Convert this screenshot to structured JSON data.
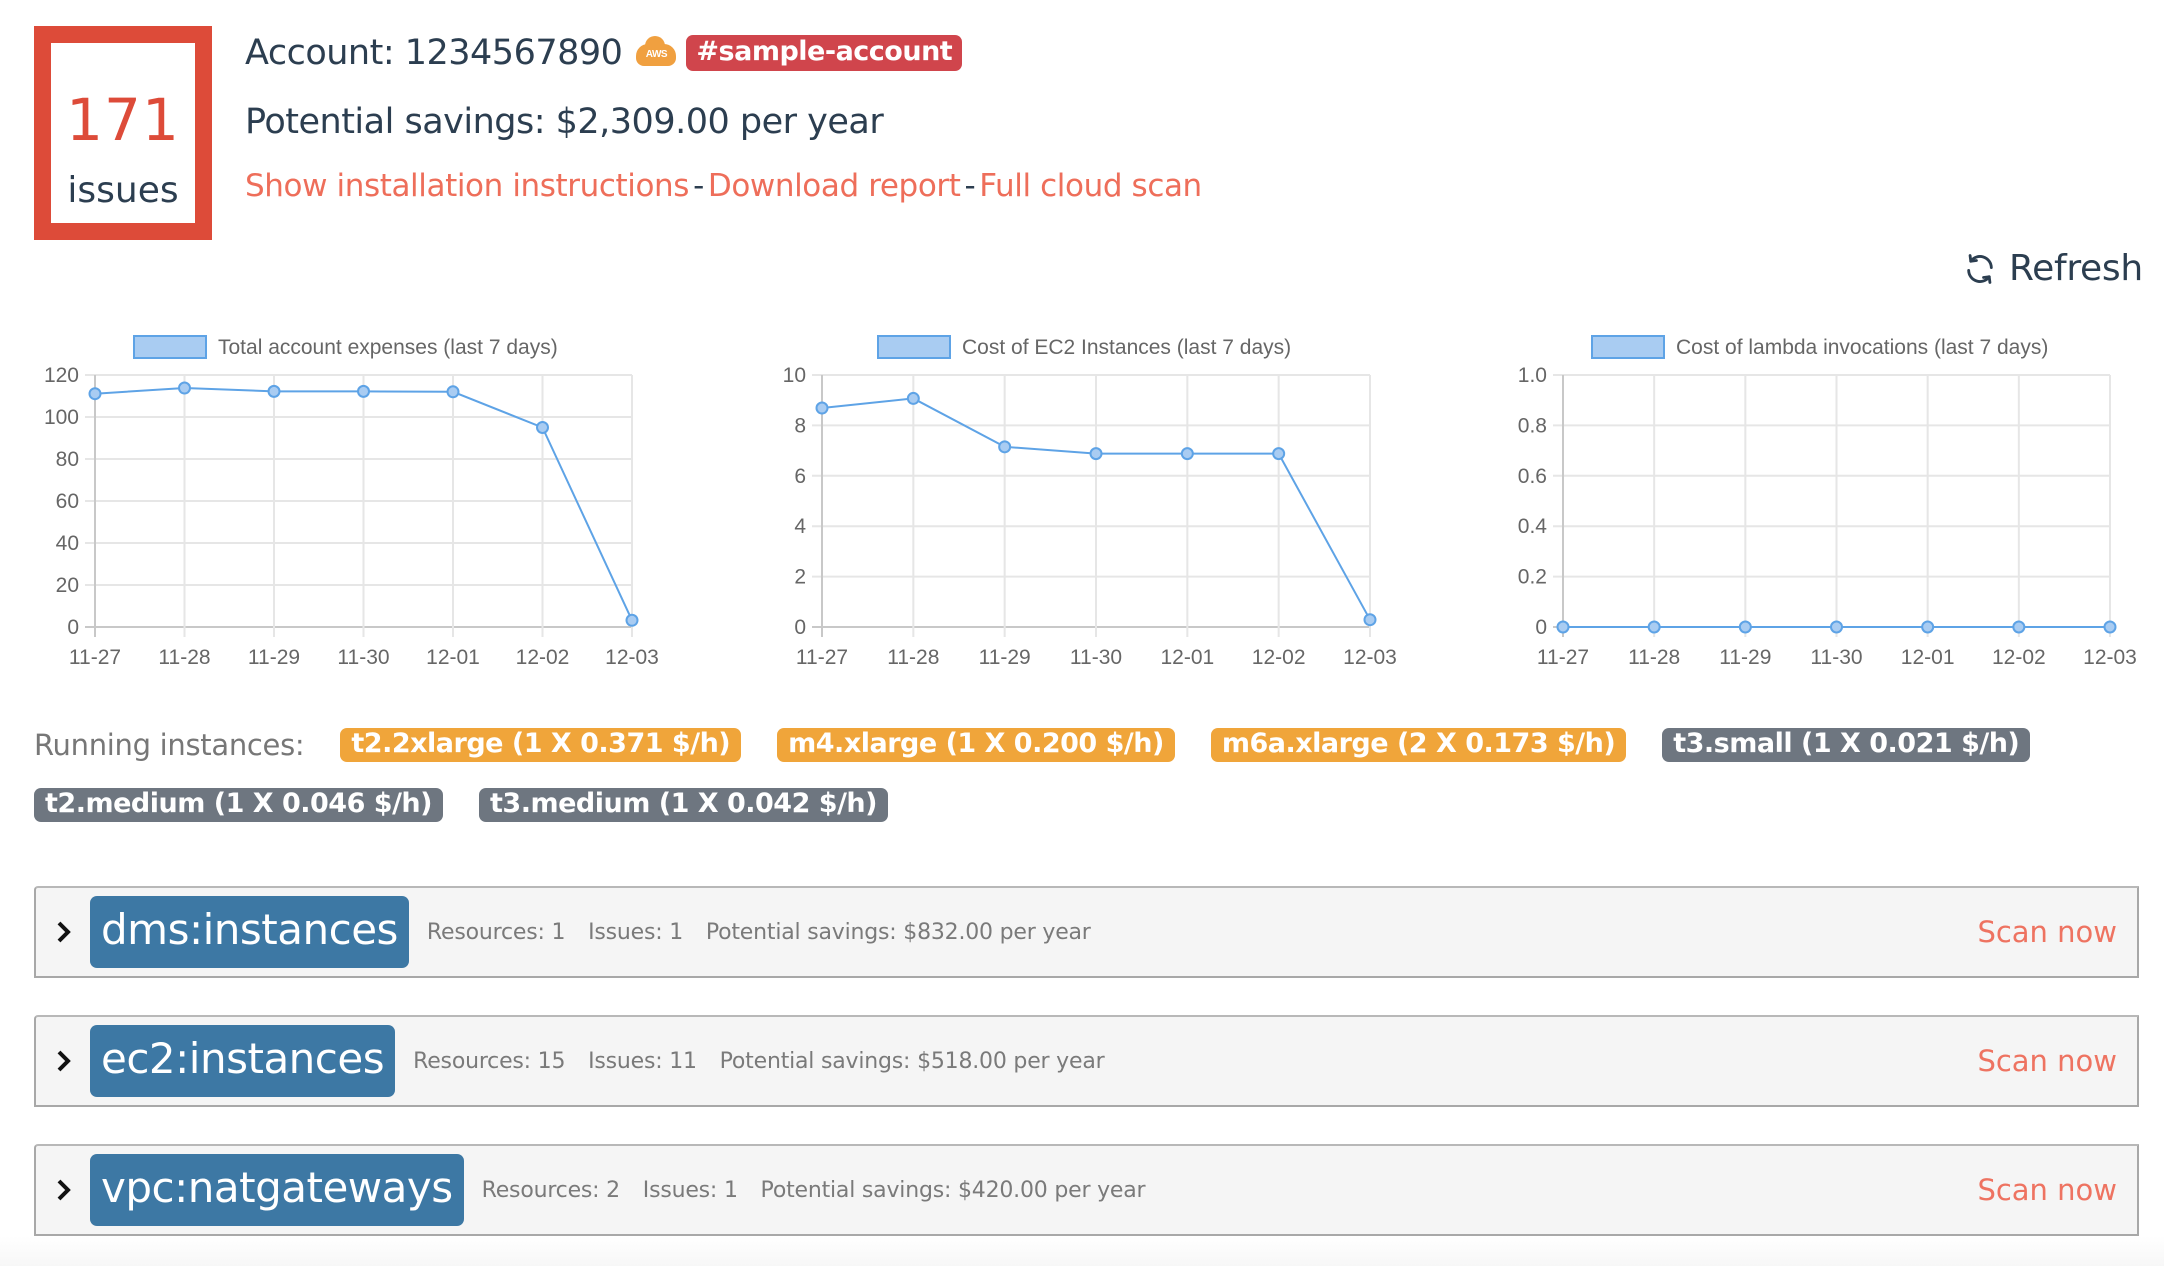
{
  "summary": {
    "issues_count": "171",
    "issues_label": "issues",
    "account_text": "Account: 1234567890",
    "provider_icon": "aws-cloud-icon",
    "provider_label": "AWS",
    "account_tag": "#sample-account",
    "savings_text": "Potential savings: $2,309.00 per year",
    "links": [
      {
        "label": "Show installation instructions"
      },
      {
        "label": "Download report"
      },
      {
        "label": "Full cloud scan"
      }
    ],
    "link_separator": "-"
  },
  "toolbar": {
    "refresh_label": "Refresh",
    "refresh_icon": "refresh-icon"
  },
  "colors": {
    "issues_red": "#dd4b39",
    "tag_red": "#d0454c",
    "link": "#ee6e5a",
    "text": "#2c3e50",
    "badge_orange": "#f0a53a",
    "badge_gray": "#6e7680",
    "service_tag_blue": "#3d78a4",
    "line_blue": "#5ea3e6",
    "point_fill": "#a9ccf2"
  },
  "chart_data": [
    {
      "type": "line",
      "title": "",
      "legend": "Total account expenses (last 7 days)",
      "legend_position": "top",
      "categories": [
        "11-27",
        "11-28",
        "11-29",
        "11-30",
        "12-01",
        "12-02",
        "12-03"
      ],
      "values": [
        111.1,
        113.8,
        112.2,
        112.2,
        112.0,
        95.0,
        3.2
      ],
      "ylim": [
        0,
        120
      ],
      "yticks": [
        "0",
        "20",
        "40",
        "60",
        "80",
        "100",
        "120"
      ],
      "xlabel": "",
      "ylabel": "",
      "grid": true
    },
    {
      "type": "line",
      "title": "",
      "legend": "Cost of EC2 Instances (last 7 days)",
      "legend_position": "top",
      "categories": [
        "11-27",
        "11-28",
        "11-29",
        "11-30",
        "12-01",
        "12-02",
        "12-03"
      ],
      "values": [
        8.69,
        9.07,
        7.15,
        6.88,
        6.88,
        6.88,
        0.29
      ],
      "ylim": [
        0,
        10
      ],
      "yticks": [
        "0",
        "2",
        "4",
        "6",
        "8",
        "10"
      ],
      "xlabel": "",
      "ylabel": "",
      "grid": true
    },
    {
      "type": "line",
      "title": "",
      "legend": "Cost of lambda invocations (last 7 days)",
      "legend_position": "top",
      "categories": [
        "11-27",
        "11-28",
        "11-29",
        "11-30",
        "12-01",
        "12-02",
        "12-03"
      ],
      "values": [
        0,
        0,
        0,
        0,
        0,
        0,
        0
      ],
      "ylim": [
        0,
        1.0
      ],
      "yticks": [
        "0",
        "0.2",
        "0.4",
        "0.6",
        "0.8",
        "1.0"
      ],
      "xlabel": "",
      "ylabel": "",
      "grid": true
    }
  ],
  "instances": {
    "label": "Running instances:",
    "items": [
      {
        "label": "t2.2xlarge (1 X 0.371 $/h)",
        "variant": "orange"
      },
      {
        "label": "m4.xlarge (1 X 0.200 $/h)",
        "variant": "orange"
      },
      {
        "label": "m6a.xlarge (2 X 0.173 $/h)",
        "variant": "orange"
      },
      {
        "label": "t3.small (1 X 0.021 $/h)",
        "variant": "gray"
      },
      {
        "label": "t2.medium (1 X 0.046 $/h)",
        "variant": "gray"
      },
      {
        "label": "t3.medium (1 X 0.042 $/h)",
        "variant": "gray"
      }
    ]
  },
  "services": [
    {
      "name": "dms:instances",
      "resources": "Resources: 1",
      "issues": "Issues: 1",
      "savings": "Potential savings: $832.00 per year",
      "action": "Scan now"
    },
    {
      "name": "ec2:instances",
      "resources": "Resources: 15",
      "issues": "Issues: 11",
      "savings": "Potential savings: $518.00 per year",
      "action": "Scan now"
    },
    {
      "name": "vpc:natgateways",
      "resources": "Resources: 2",
      "issues": "Issues: 1",
      "savings": "Potential savings: $420.00 per year",
      "action": "Scan now"
    }
  ]
}
